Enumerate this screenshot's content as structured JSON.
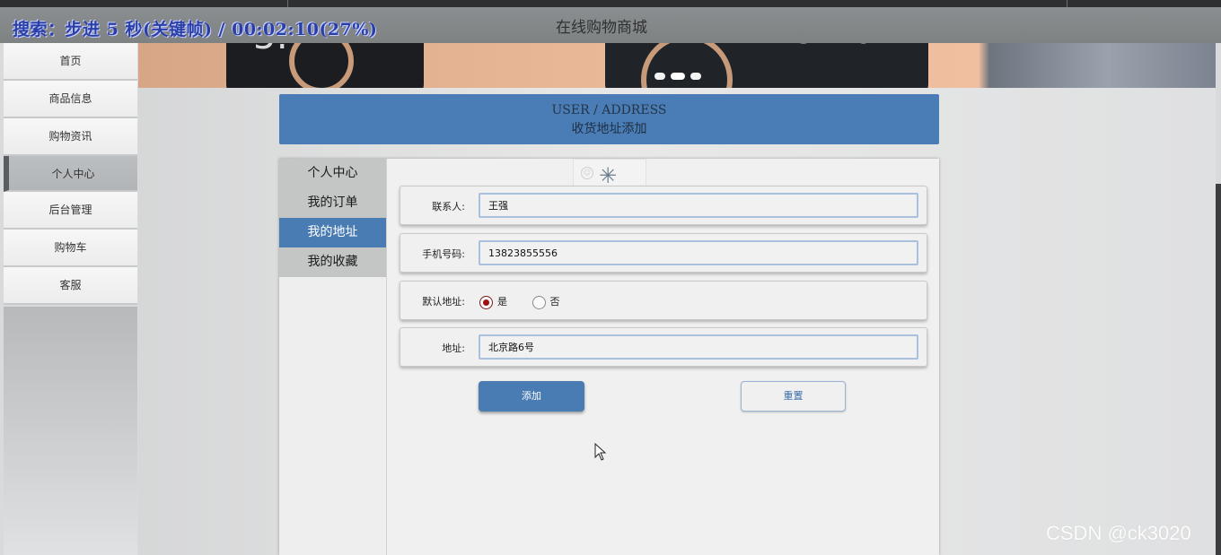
{
  "overlay": {
    "text": "搜索：步进 5 秒(关键帧) / 00:02:10(27%)"
  },
  "site": {
    "title": "在线购物商城"
  },
  "sidebar": {
    "items": [
      {
        "label": "首页"
      },
      {
        "label": "商品信息"
      },
      {
        "label": "购物资讯"
      },
      {
        "label": "个人中心",
        "active": true
      },
      {
        "label": "后台管理"
      },
      {
        "label": "购物车"
      },
      {
        "label": "客服"
      }
    ]
  },
  "section": {
    "title_en": "USER / ADDRESS",
    "title_zh": "收货地址添加"
  },
  "tabs": [
    {
      "label": "个人中心"
    },
    {
      "label": "我的订单"
    },
    {
      "label": "我的地址",
      "active": true
    },
    {
      "label": "我的收藏"
    }
  ],
  "form": {
    "contact_label": "联系人:",
    "contact_value": "王强",
    "phone_label": "手机号码:",
    "phone_value": "13823855556",
    "default_label": "默认地址:",
    "default_options": [
      "是",
      "否"
    ],
    "default_selected": "是",
    "address_label": "地址:",
    "address_value": "北京路6号"
  },
  "buttons": {
    "add": "添加",
    "reset": "重置"
  },
  "watermark": "CSDN @ck3020",
  "colors": {
    "accent": "#4a7cb4",
    "header": "#808485"
  }
}
